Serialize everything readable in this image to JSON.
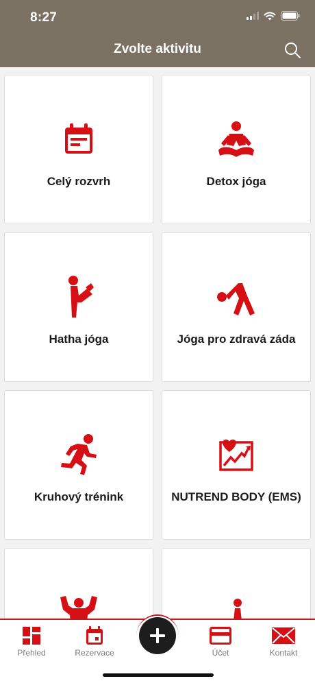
{
  "status_bar": {
    "time": "8:27"
  },
  "header": {
    "title": "Zvolte aktivitu",
    "search_icon": "search-icon"
  },
  "colors": {
    "accent": "#d60f14",
    "header_bg": "#7a7163",
    "fab_bg": "#1d1d1d"
  },
  "activities": [
    {
      "label": "Celý rozvrh",
      "icon": "calendar-icon"
    },
    {
      "label": "Detox jóga",
      "icon": "meditation-icon"
    },
    {
      "label": "Hatha jóga",
      "icon": "stretching-person-icon"
    },
    {
      "label": "Jóga pro zdravá záda",
      "icon": "bending-person-icon"
    },
    {
      "label": "Kruhový trénink",
      "icon": "running-person-icon"
    },
    {
      "label": "NUTREND BODY (EMS)",
      "icon": "heart-chart-icon"
    },
    {
      "label": "",
      "icon": "strongman-icon"
    },
    {
      "label": "",
      "icon": "yoga-pose-icon"
    }
  ],
  "tabbar": {
    "items": [
      {
        "label": "Přehled",
        "icon": "dashboard-icon"
      },
      {
        "label": "Rezervace",
        "icon": "calendar-icon"
      },
      {
        "label": "Účet",
        "icon": "card-icon"
      },
      {
        "label": "Kontakt",
        "icon": "envelope-icon"
      }
    ],
    "center_icon": "plus-icon"
  }
}
